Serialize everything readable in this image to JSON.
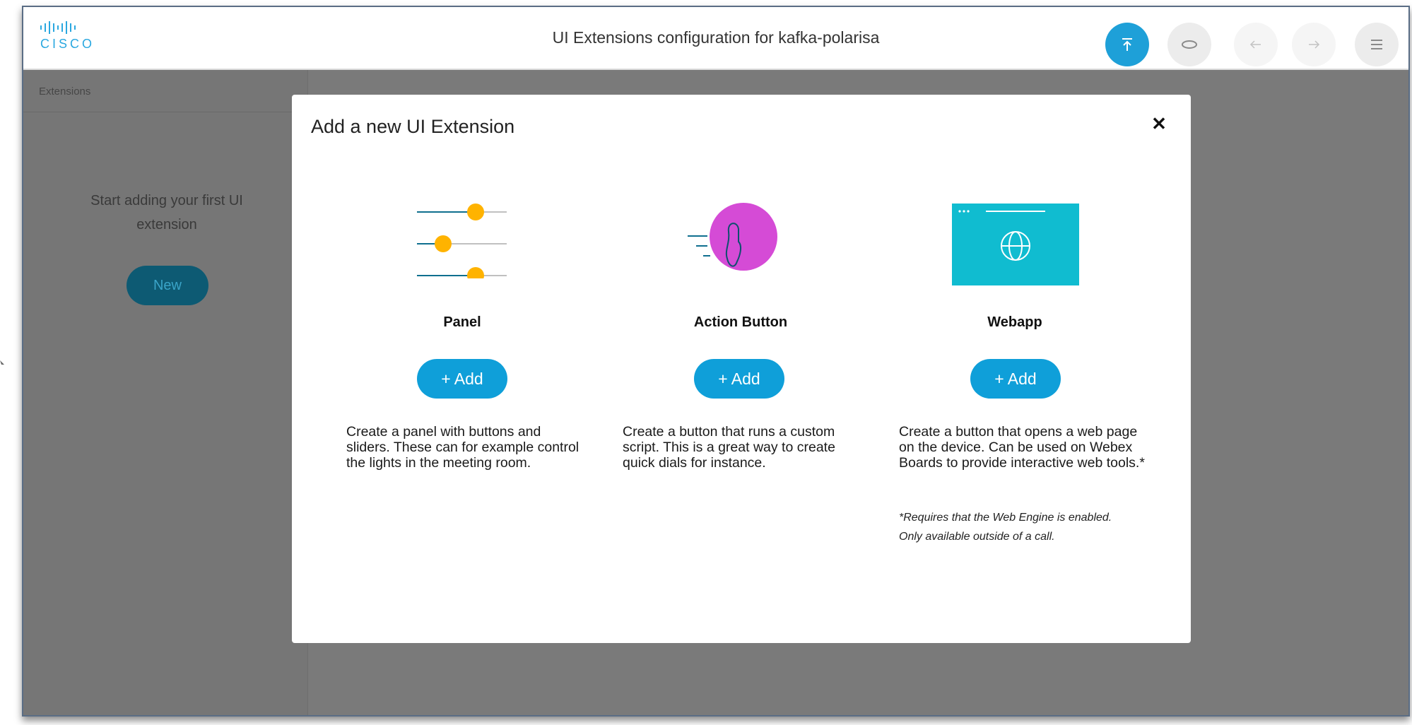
{
  "header": {
    "logo_text": "CISCO",
    "title": "UI Extensions configuration for kafka-polarisa",
    "buttons": [
      "upload-icon",
      "preview-icon",
      "undo-icon",
      "redo-icon",
      "menu-icon"
    ]
  },
  "sidebar": {
    "heading": "Extensions",
    "message": "Start adding your first UI extension",
    "new_label": "New"
  },
  "modal": {
    "title": "Add a new UI Extension",
    "close_label": "✕",
    "options": [
      {
        "name": "Panel",
        "add_label": "+ Add",
        "description": "Create a panel with buttons and sliders. These can for example control the lights in the meeting room.",
        "icon": "sliders-icon"
      },
      {
        "name": "Action Button",
        "add_label": "+ Add",
        "description": "Create a button that runs a custom script. This is a great way to create quick dials for instance.",
        "icon": "touch-hand-icon"
      },
      {
        "name": "Webapp",
        "add_label": "+ Add",
        "description": "Create a button that opens a web page on the device. Can be used on Webex Boards to provide interactive web tools.*",
        "note": "*Requires that the Web Engine is enabled. Only available outside of a call.",
        "icon": "browser-globe-icon"
      }
    ]
  },
  "colors": {
    "accent": "#0f9fd9",
    "slider_knob": "#ffb300",
    "action_circle": "#d54bd6",
    "webapp_tile": "#10bcd0"
  }
}
